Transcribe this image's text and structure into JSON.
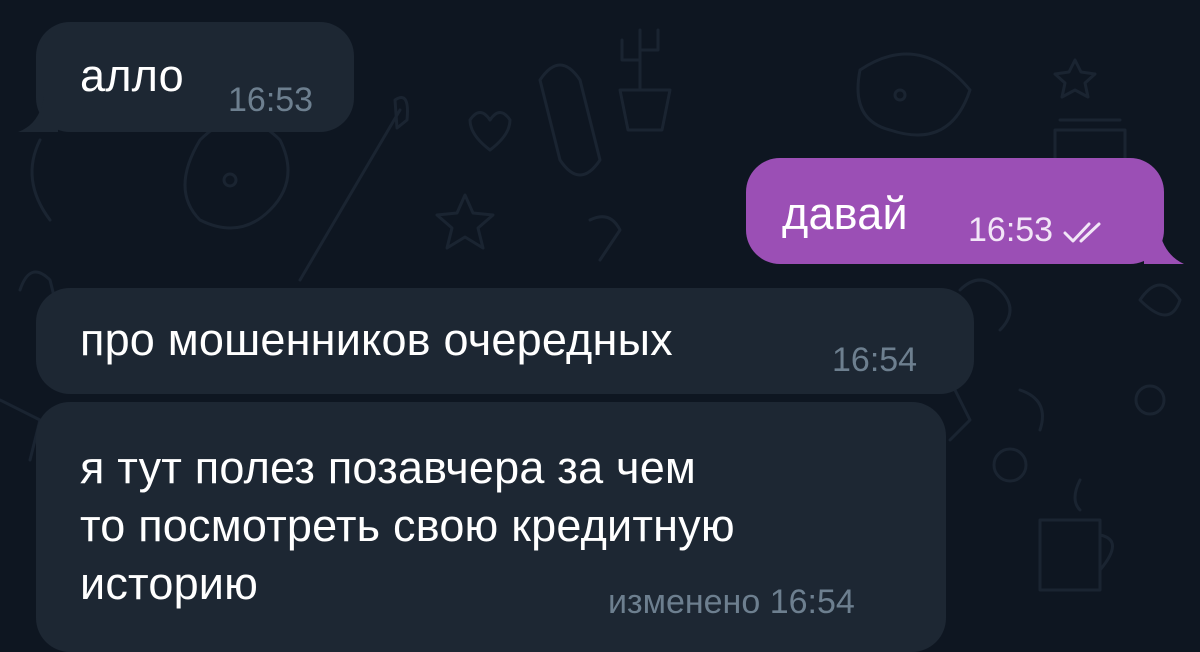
{
  "messages": [
    {
      "text": "алло",
      "time": "16:53"
    },
    {
      "text": "давай",
      "time": "16:53",
      "status_icon": "double-check-icon"
    },
    {
      "text": "про мошенников очередных",
      "time": "16:54"
    },
    {
      "lines": [
        "я тут полез позавчера за чем",
        "то посмотреть свою кредитную",
        "историю"
      ],
      "edited_label": "изменено",
      "time": "16:54"
    }
  ],
  "colors": {
    "background": "#0e1621",
    "incoming_bubble": "#1d2733",
    "outgoing_bubble": "#9b4fb5",
    "incoming_meta": "#6d7f8f"
  }
}
